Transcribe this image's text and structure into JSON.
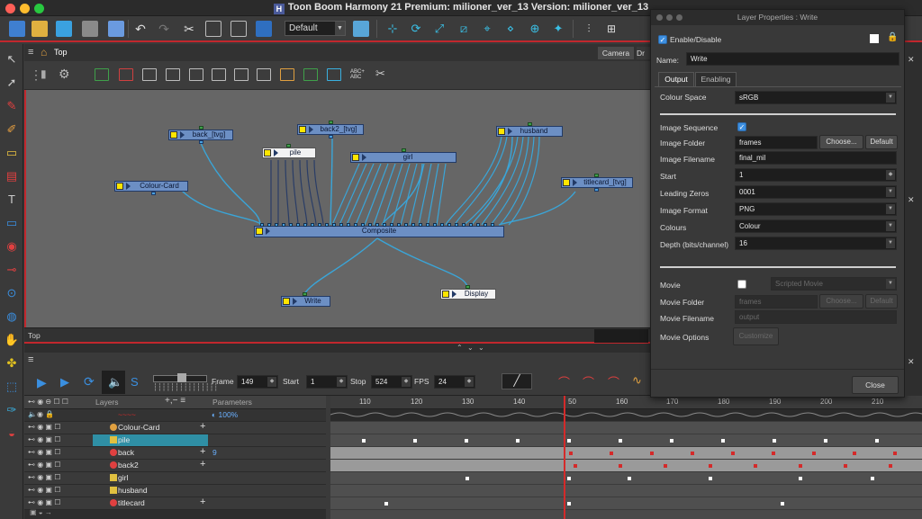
{
  "window": {
    "title": "Toon Boom Harmony 21 Premium: milioner_ver_13 Version: milioner_ver_13"
  },
  "toolbar": {
    "workspace": "Default"
  },
  "node_view": {
    "breadcrumb": "Top",
    "tabs": [
      "Camera",
      "Dr"
    ],
    "footer_label": "Top",
    "nodes": {
      "back": "back_[tvg]",
      "back2": "back2_[tvg]",
      "pile": "pile",
      "husband": "husband",
      "girl": "girl",
      "colour_card": "Colour-Card",
      "titlecard": "titlecard_[tvg]",
      "composite": "Composite",
      "write": "Write",
      "display": "Display"
    }
  },
  "timeline": {
    "frame_label": "Frame",
    "frame": "149",
    "start_label": "Start",
    "start": "1",
    "stop_label": "Stop",
    "stop": "524",
    "fps_label": "FPS",
    "fps": "24",
    "layers_header": "Layers",
    "parameters_header": "Parameters",
    "top_row_value": "100%",
    "ruler": [
      "110",
      "120",
      "130",
      "140",
      "50",
      "160",
      "170",
      "180",
      "190",
      "200",
      "210"
    ],
    "layers": [
      {
        "name": "Colour-Card",
        "param": ""
      },
      {
        "name": "pile",
        "param": ""
      },
      {
        "name": "back",
        "param": "9"
      },
      {
        "name": "back2",
        "param": ""
      },
      {
        "name": "girl",
        "param": ""
      },
      {
        "name": "husband",
        "param": ""
      },
      {
        "name": "titlecard",
        "param": ""
      }
    ]
  },
  "layer_properties": {
    "title": "Layer Properties : Write",
    "enable_disable": "Enable/Disable",
    "name_label": "Name:",
    "name": "Write",
    "tabs": [
      "Output",
      "Enabling"
    ],
    "colour_space_label": "Colour Space",
    "colour_space": "sRGB",
    "image_sequence_label": "Image Sequence",
    "image_folder_label": "Image Folder",
    "image_folder": "frames",
    "choose": "Choose...",
    "default": "Default",
    "image_filename_label": "Image Filename",
    "image_filename": "final_mil",
    "start_label": "Start",
    "start": "1",
    "leading_zeros_label": "Leading Zeros",
    "leading_zeros": "0001",
    "image_format_label": "Image Format",
    "image_format": "PNG",
    "colours_label": "Colours",
    "colours": "Colour",
    "depth_label": "Depth (bits/channel)",
    "depth": "16",
    "movie_label": "Movie",
    "movie_type": "Scripted Movie",
    "movie_folder_label": "Movie Folder",
    "movie_folder": "frames",
    "movie_filename_label": "Movie Filename",
    "movie_filename": "output",
    "movie_options_label": "Movie Options",
    "customize": "Customize",
    "close": "Close"
  },
  "colors": {
    "accent_red": "#c2272d",
    "node_blue": "#6c8fc4",
    "checkbox_blue": "#3d8fe0",
    "playhead": "#d42a2a"
  }
}
